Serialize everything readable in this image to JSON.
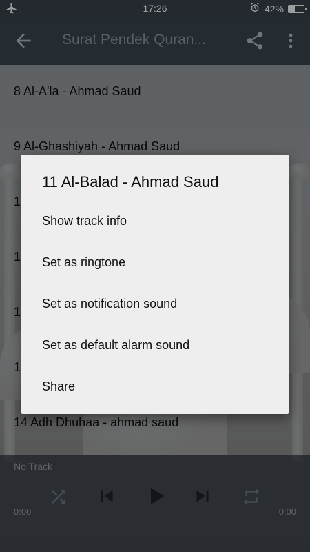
{
  "status_bar": {
    "time": "17:26",
    "battery": "42%",
    "battery_level": 0.42,
    "icons": [
      "airplane-icon",
      "alarm-icon",
      "battery-icon"
    ]
  },
  "app_bar": {
    "title": "Surat Pendek Quran...",
    "back_icon": "arrow-back-icon",
    "share_icon": "share-icon",
    "more_icon": "more-vert-icon"
  },
  "list": {
    "items": [
      "8 Al-A'la - Ahmad Saud",
      "9 Al-Ghashiyah - Ahmad Saud",
      "1",
      "1",
      "1",
      "1",
      "14 Adh Dhuhaa - ahmad saud"
    ]
  },
  "player": {
    "track": "No Track",
    "elapsed": "0:00",
    "duration": "0:00",
    "controls": [
      "shuffle-icon",
      "skip-previous-icon",
      "play-icon",
      "skip-next-icon",
      "repeat-icon"
    ]
  },
  "dialog": {
    "title": "11 Al-Balad - Ahmad Saud",
    "options": [
      "Show track info",
      "Set as ringtone",
      "Set as notification sound",
      "Set as default alarm sound",
      "Share"
    ]
  },
  "colors": {
    "status_bar": "#39434c",
    "app_bar": "#3a4650",
    "dialog_bg": "#eeeeee",
    "player_text": "#9aa2aa"
  }
}
